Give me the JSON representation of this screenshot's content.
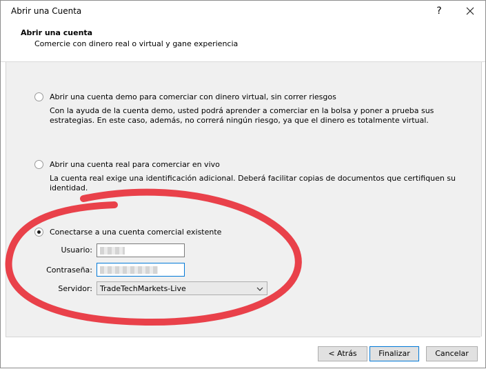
{
  "window": {
    "title": "Abrir una Cuenta",
    "help_label": "?"
  },
  "header": {
    "title": "Abrir una cuenta",
    "subtitle": "Comercie con dinero real o virtual y gane experiencia"
  },
  "options": [
    {
      "label": "Abrir una cuenta demo para comerciar con dinero virtual, sin correr riesgos",
      "description": "Con la ayuda de la cuenta demo, usted podrá aprender a comerciar en la bolsa y poner a prueba sus estrategias. En este caso, además, no correrá ningún riesgo, ya que el dinero es totalmente virtual.",
      "checked": false
    },
    {
      "label": "Abrir una cuenta real para comerciar en vivo",
      "description": "La cuenta real exige una identificación adicional. Deberá facilitar copias de documentos que certifiquen su identidad.",
      "checked": false
    },
    {
      "label": "Conectarse a una cuenta comercial existente",
      "checked": true
    }
  ],
  "login": {
    "user_label": "Usuario:",
    "password_label": "Contraseña:",
    "server_label": "Servidor:",
    "server_value": "TradeTechMarkets-Live"
  },
  "buttons": {
    "back": "< Atrás",
    "finish": "Finalizar",
    "cancel": "Cancelar"
  },
  "colors": {
    "annotation": "#e8323c",
    "focus": "#0078d7"
  }
}
